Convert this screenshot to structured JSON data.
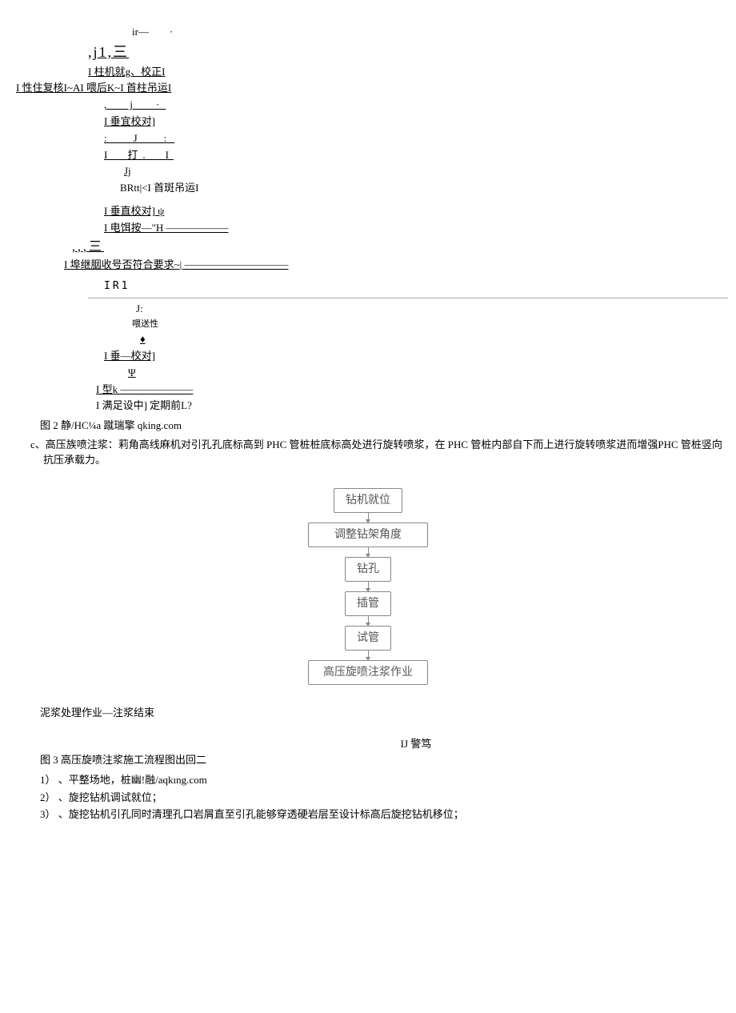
{
  "garbled": {
    "l1": "ir—　　·",
    "l2": ",j1,三",
    "l3": "I 柱机就g、校正I",
    "l4": "I 性住复核I~AI 喂后K~I 首柱吊运I",
    "l5": ",　j　·",
    "l6": "I 垂宜校对]",
    "l7": ":　J　:",
    "l8": "I　打.　I",
    "l9": "Jj",
    "l10": "BRtt|<I 首斑吊运I",
    "l11": "I 垂直校对] ψ",
    "l12": "I 电饵按—\"H ——————",
    "l13": ",,,三",
    "l14": "I 埠继胭收号否符合要求~| ——————————",
    "l15": "IR1",
    "l16": "J:",
    "l17": "喂送性",
    "l18": "♦",
    "l19": "I 垂—校对]",
    "l20": "Ψ",
    "l21": "I 型k ———————",
    "l22": "I 满足设中] 定期前L?"
  },
  "fig2": "图 2 静/HC¼a 蹴瑞擎 qking.com",
  "para_c": "c、高压族喷注浆：莉角高线麻机对引孔孔底标高到 PHC 管桩桩底标高处进行旋转喷浆，在 PHC 管桩内部自下而上进行旋转喷浆进而增强PHC 管桩竖向抗压承载力。",
  "flow": {
    "b1": "钻机就位",
    "b2": "调整钻架角度",
    "b3": "钻孔",
    "b4": "插管",
    "b5": "试管",
    "b6": "高压旋喷注浆作业"
  },
  "mud": "泥浆处理作业—注浆结束",
  "ij": "IJ 警笃",
  "fig3": "图 3 高压旋喷注浆施工流程图出回二",
  "steps": {
    "s1": "1） 、平整场地，桩幽!融/aqkıng.com",
    "s2": "2） 、旋挖钻机调试就位；",
    "s3": "3） 、旋挖钻机引孔同时清理孔口岩屑直至引孔能够穿透硬岩层至设计标高后旋挖钻机移位；"
  }
}
